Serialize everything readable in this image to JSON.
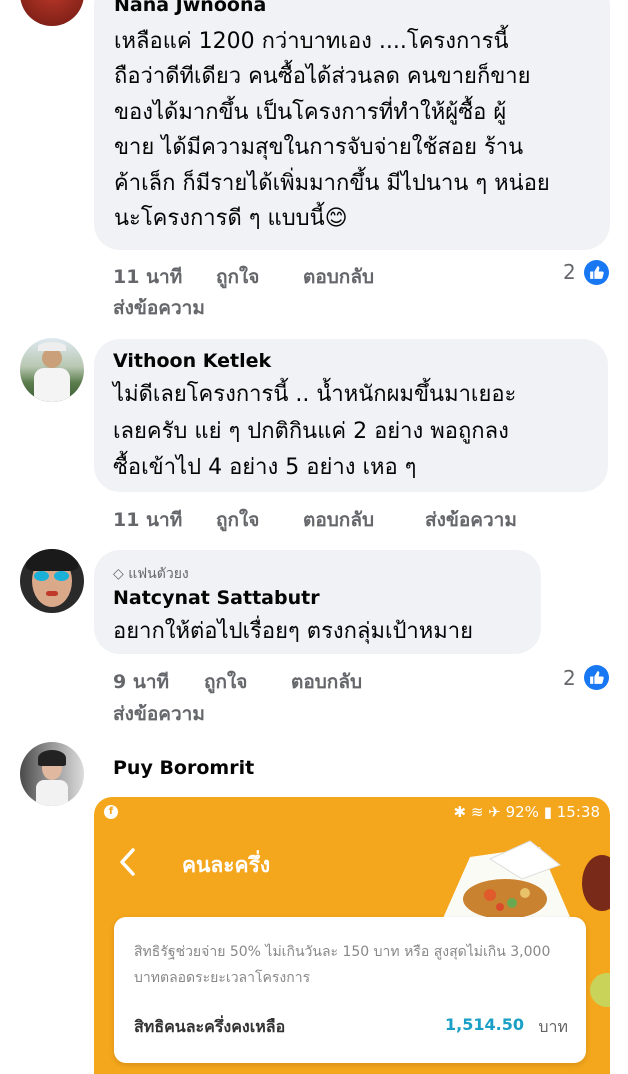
{
  "comments": [
    {
      "author": "Nana Jwnoona",
      "lines": [
        "เหลือแค่ 1200 กว่าบาทเอง ....โครงการนี้",
        "ถือว่าดีทีเดียว คนซื้อได้ส่วนลด คนขายก็ขาย",
        "ของได้มากขึ้น เป็นโครงการที่ทำให้ผู้ซื้อ ผู้",
        "ขาย ได้มีความสุขในการจับจ่ายใช้สอย ร้าน",
        "ค้าเล็ก ก็มีรายได้เพิ่มมากขึ้น มีไปนาน ๆ หน่อย",
        "นะโครงการดี ๆ แบบนี้😊"
      ],
      "time": "11 นาที",
      "like": "ถูกใจ",
      "reply": "ตอบกลับ",
      "message": "ส่งข้อความ",
      "reactions": "2"
    },
    {
      "author": "Vithoon Ketlek",
      "lines": [
        "ไม่ดีเลยโครงการนี้ .. น้ำหนักผมขึ้นมาเยอะ",
        "เลยครับ แย่ ๆ ปกติกินแค่ 2 อย่าง พอถูกลง",
        "ซื้อเข้าไป 4 อย่าง 5 อย่าง เหอ ๆ"
      ],
      "time": "11 นาที",
      "like": "ถูกใจ",
      "reply": "ตอบกลับ",
      "message": "ส่งข้อความ"
    },
    {
      "badge": "แฟนตัวยง",
      "author": "Natcynat Sattabutr",
      "lines": [
        "อยากให้ต่อไปเรื่อยๆ ตรงกลุ่มเป้าหมาย"
      ],
      "time": "9 นาที",
      "like": "ถูกใจ",
      "reply": "ตอบกลับ",
      "message": "ส่งข้อความ",
      "reactions": "2"
    },
    {
      "author": "Puy Boromrit"
    }
  ],
  "attachment": {
    "status_time": "15:38",
    "battery": "92%",
    "app_title": "คนละครึ่ง",
    "description": "สิทธิรัฐช่วยจ่าย 50% ไม่เกินวันละ 150 บาท หรือ สูงสุดไม่เกิน 3,000 บาทตลอดระยะเวลาโครงการ",
    "balance_label": "สิทธิคนละครึ่งคงเหลือ",
    "balance_amount": "1,514.50",
    "balance_unit": "บาท",
    "bg_color": "#f4a61c",
    "amount_color": "#1aa0c6"
  },
  "like_color": "#1877f2"
}
